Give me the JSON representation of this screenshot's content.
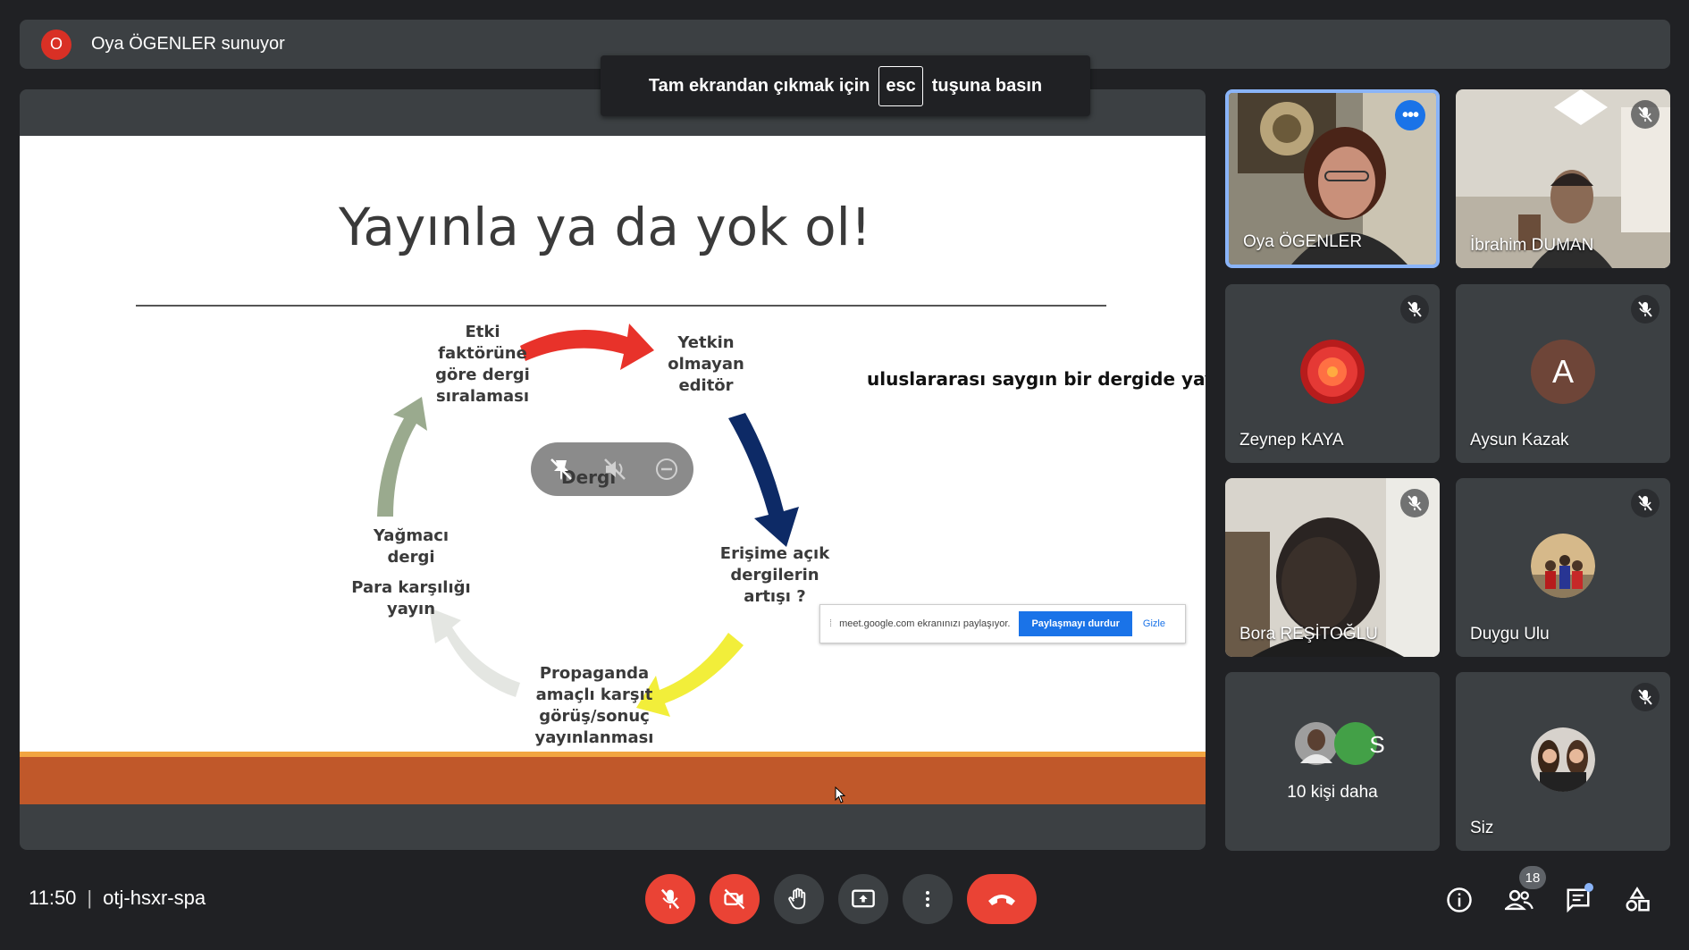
{
  "presenter": {
    "initial": "O",
    "text": "Oya ÖGENLER sunuyor"
  },
  "fullscreen_toast": {
    "before": "Tam ekrandan çıkmak için",
    "key": "esc",
    "after": "tuşuna basın"
  },
  "slide": {
    "title": "Yayınla ya da yok ol!",
    "side_note": "uluslararası saygın bir dergide yayın",
    "center_word": "Dergi",
    "cycle": {
      "impact": [
        "Etki",
        "faktörüne",
        "göre dergi",
        "sıralaması"
      ],
      "editor": [
        "Yetkin",
        "olmayan",
        "editör"
      ],
      "open_access": [
        "Erişime açık",
        "dergilerin",
        "artışı ?"
      ],
      "propaganda": [
        "Propaganda",
        "amaçlı karşıt",
        "görüş/sonuç",
        "yayınlanması"
      ],
      "predatory": [
        "Yağmacı",
        "dergi"
      ],
      "paid": [
        "Para karşılığı",
        "yayın"
      ]
    },
    "arrow_colors": {
      "red": "#e8322a",
      "navy": "#0d2a66",
      "yellow": "#f2ee3a",
      "light_gray": "#e4e6e2",
      "sage": "#9aaa8e"
    }
  },
  "share_banner": {
    "text": "meet.google.com ekranınızı paylaşıyor.",
    "stop_label": "Paylaşmayı durdur",
    "hide_label": "Gizle"
  },
  "participants": [
    {
      "name": "Oya ÖGENLER",
      "muted": false,
      "active": true,
      "type": "video"
    },
    {
      "name": "İbrahim DUMAN",
      "muted": true,
      "type": "video"
    },
    {
      "name": "Zeynep KAYA",
      "muted": true,
      "type": "avatar"
    },
    {
      "name": "Aysun Kazak",
      "muted": true,
      "type": "letter",
      "letter": "A"
    },
    {
      "name": "Bora REŞİTOĞLU",
      "muted": true,
      "type": "video"
    },
    {
      "name": "Duygu Ulu",
      "muted": true,
      "type": "avatar"
    },
    {
      "name": "10 kişi daha",
      "type": "group",
      "letter": "S"
    },
    {
      "name": "Siz",
      "muted": true,
      "type": "avatar"
    }
  ],
  "bottom_bar": {
    "time": "11:50",
    "meeting_code": "otj-hsxr-spa",
    "people_count": "18"
  },
  "colors": {
    "background": "#202124",
    "tile": "#3c4043",
    "danger": "#ea4335",
    "accent": "#1a73e8",
    "active_border": "#8ab4f8"
  }
}
